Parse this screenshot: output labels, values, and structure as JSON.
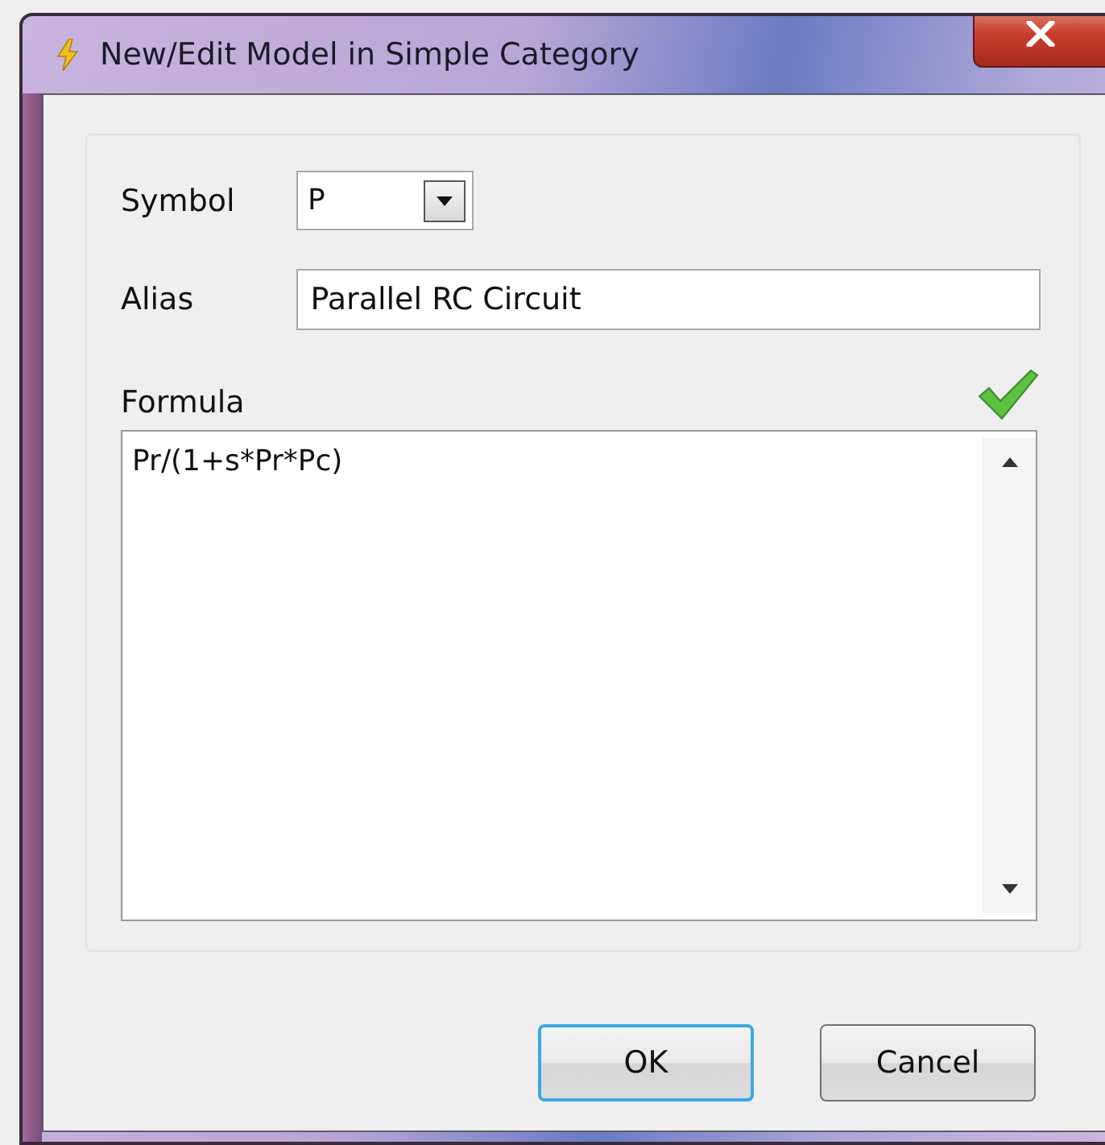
{
  "window": {
    "title": "New/Edit Model in Simple Category"
  },
  "symbol": {
    "label": "Symbol",
    "value": "P"
  },
  "alias": {
    "label": "Alias",
    "value": "Parallel RC Circuit"
  },
  "formula": {
    "label": "Formula",
    "value": "Pr/(1+s*Pr*Pc)",
    "valid": true
  },
  "buttons": [
    {
      "label": "OK",
      "default": true
    },
    {
      "label": "Cancel",
      "default": false
    }
  ]
}
